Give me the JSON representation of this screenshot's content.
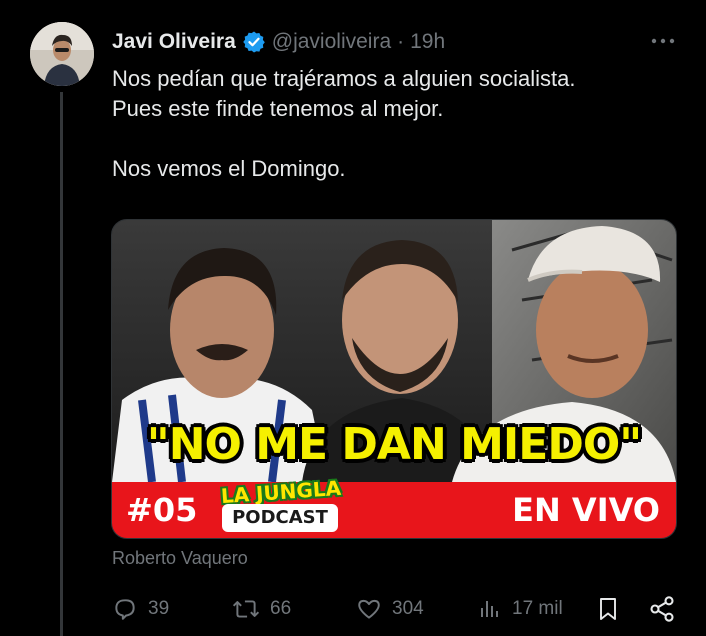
{
  "tweet": {
    "author_name": "Javi Oliveira",
    "handle": "@javioliveira",
    "separator": "·",
    "time": "19h",
    "more_label": "···",
    "text_lines": [
      "Nos pedían que trajéramos a alguien socialista.",
      "Pues este finde tenemos al mejor.",
      "Nos vemos el Domingo."
    ],
    "media": {
      "headline": "\"NO ME DAN MIEDO\"",
      "episode": "#05",
      "logo_top": "LA JUNGLA",
      "logo_bottom": "PODCAST",
      "badge": "EN VIVO"
    },
    "attribution": "Roberto Vaquero",
    "actions": {
      "replies": "39",
      "reposts": "66",
      "likes": "304",
      "views": "17 mil"
    }
  },
  "colors": {
    "background": "#000000",
    "text_primary": "#e7e9ea",
    "text_secondary": "#71767b",
    "verified_blue": "#1d9bf0",
    "headline_yellow": "#f5f000",
    "band_red": "#e8151b"
  },
  "icons": {
    "verified": "verified-badge-icon",
    "reply": "reply-icon",
    "repost": "repost-icon",
    "like": "heart-icon",
    "views": "views-icon",
    "bookmark": "bookmark-icon",
    "share": "share-icon"
  }
}
